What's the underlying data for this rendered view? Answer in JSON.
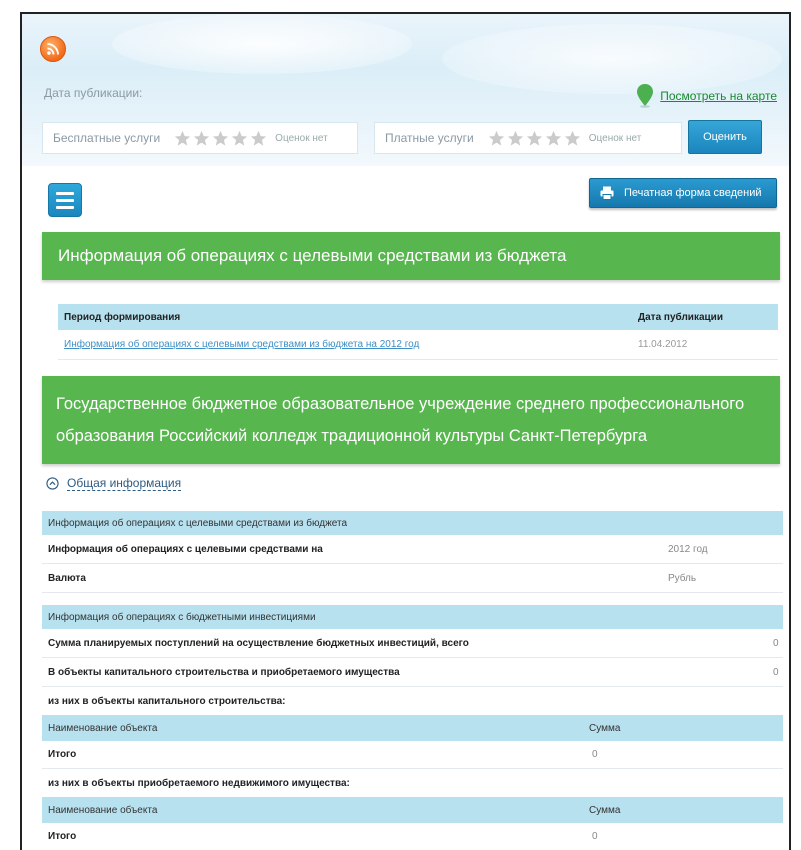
{
  "header": {
    "publication_date_label": "Дата публикации:",
    "map_link": "Посмотреть на карте",
    "free_services_label": "Бесплатные услуги",
    "free_rating_count": "Оценок нет",
    "paid_services_label": "Платные услуги",
    "paid_rating_count": "Оценок нет",
    "rate_button": "Оценить"
  },
  "toolbar": {
    "print_button": "Печатная форма сведений"
  },
  "section_title": "Информация об операциях с целевыми средствами из бюджета",
  "reports_table": {
    "columns": [
      "Период формирования",
      "Дата публикации"
    ],
    "rows": [
      {
        "period": "Информация об операциях с целевыми средствами из бюджета на 2012 год",
        "date": "11.04.2012"
      }
    ]
  },
  "institution_title": "Государственное бюджетное образовательное учреждение среднего профессионального образования Российский колледж традиционной культуры Санкт-Петербурга",
  "general_toggle": "Общая информация",
  "details": {
    "section1_title": "Информация об операциях с целевыми средствами из бюджета",
    "operations_label": "Информация об операциях с целевыми средствами на",
    "operations_value": "2012 год",
    "currency_label": "Валюта",
    "currency_value": "Рубль",
    "section2_title": "Информация об операциях с бюджетными инвестициями",
    "planned_label": "Сумма планируемых поступлений на осуществление бюджетных инвестиций, всего",
    "planned_value": "0",
    "capital_label": "В объекты капитального строительства и приобретаемого имущества",
    "capital_value": "0",
    "sub1_title": "из них в объекты капитального строительства:",
    "sub1_col_name": "Наименование объекта",
    "sub1_col_sum": "Сумма",
    "sub1_total_label": "Итого",
    "sub1_total_value": "0",
    "sub2_title": "из них в объекты приобретаемого недвижимого имущества:",
    "sub2_col_name": "Наименование объекта",
    "sub2_col_sum": "Сумма",
    "sub2_total_label": "Итого",
    "sub2_total_value": "0"
  },
  "colors": {
    "green_banner": "#58b64f",
    "accent_blue": "#1b86bd",
    "table_header": "#b8e1ef",
    "link": "#3e8fc6"
  },
  "icons": [
    "rss-icon",
    "map-pin-icon",
    "star-icon",
    "menu-icon",
    "printer-icon",
    "collapse-circle-icon"
  ]
}
